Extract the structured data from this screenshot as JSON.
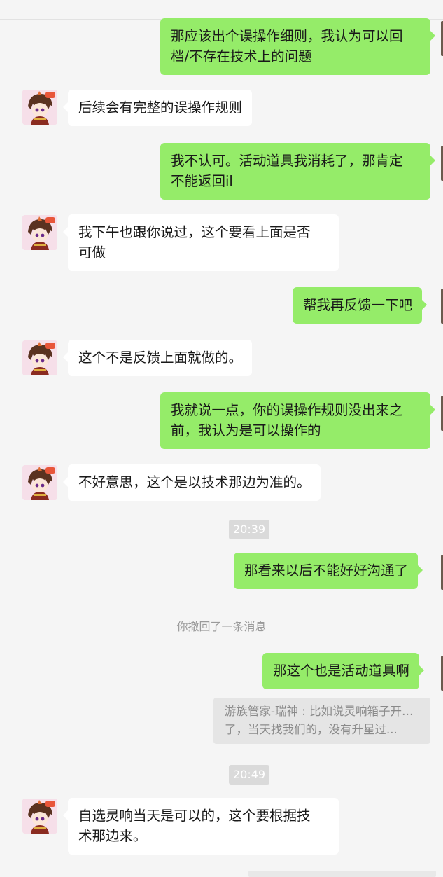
{
  "colors": {
    "background": "#f5f5f5",
    "outgoing_bubble": "#95ec69",
    "incoming_bubble": "#ffffff",
    "timestamp_bg": "#dadada"
  },
  "messages": [
    {
      "dir": "out",
      "lines": [
        "那应该出个误操作细则，我认为可以回",
        "档/不存在技术上的问题"
      ]
    },
    {
      "dir": "in",
      "lines": [
        "后续会有完整的误操作规则"
      ]
    },
    {
      "dir": "out",
      "lines": [
        "我不认可。活动道具我消耗了，那肯定",
        "不能返回il"
      ]
    },
    {
      "dir": "in",
      "lines": [
        "我下午也跟你说过，这个要看上面是否",
        "可做"
      ]
    },
    {
      "dir": "out",
      "lines": [
        "帮我再反馈一下吧"
      ]
    },
    {
      "dir": "in",
      "lines": [
        "这个不是反馈上面就做的。"
      ]
    },
    {
      "dir": "out",
      "lines": [
        "我就说一点，你的误操作规则没出来之",
        "前，我认为是可以操作的"
      ]
    },
    {
      "dir": "in",
      "lines": [
        "不好意思，这个是以技术那边为准的。"
      ]
    },
    {
      "dir": "out",
      "lines": [
        "那看来以后不能好好沟通了"
      ]
    },
    {
      "dir": "out",
      "lines": [
        "那这个也是活动道具啊"
      ]
    },
    {
      "dir": "in",
      "lines": [
        "自选灵响当天是可以的，这个要根据技",
        "术那边来。"
      ]
    }
  ],
  "timestamps": [
    "20:39",
    "20:49"
  ],
  "system_notice": "你撤回了一条消息",
  "quote": {
    "line1": "游族管家-瑞神 : 比如说灵响箱子开了，",
    "line2": "了，当天找我们的，没有升星过..."
  }
}
